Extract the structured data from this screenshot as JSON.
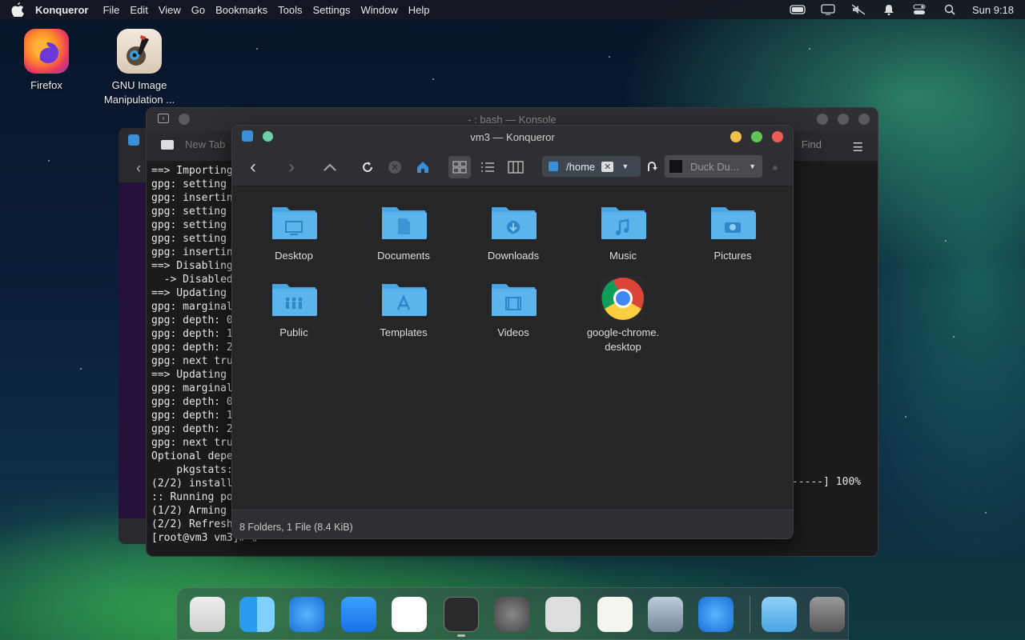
{
  "menubar": {
    "app_name": "Konqueror",
    "menus": [
      "File",
      "Edit",
      "View",
      "Go",
      "Bookmarks",
      "Tools",
      "Settings",
      "Window",
      "Help"
    ],
    "clock": "Sun 9:18"
  },
  "desktop": {
    "icons": [
      {
        "label": "Firefox",
        "icon": "firefox-icon"
      },
      {
        "label": "GNU Image Manipulation ...",
        "icon": "gimp-icon"
      }
    ]
  },
  "konsole": {
    "title": "- : bash — Konsole",
    "new_tab": "New Tab",
    "find": "Find",
    "terminal_lines": [
      "==> Importing",
      "gpg: setting",
      "gpg: insertin",
      "gpg: setting",
      "gpg: setting",
      "gpg: setting",
      "gpg: insertin",
      "==> Disabling",
      "  -> Disabled",
      "==> Updating",
      "gpg: marginal",
      "gpg: depth: 0",
      "gpg: depth: 1",
      "gpg: depth: 2",
      "gpg: next tru",
      "==> Updating",
      "gpg: marginal",
      "gpg: depth: 0",
      "gpg: depth: 1",
      "gpg: depth: 2",
      "gpg: next tru",
      "Optional depe",
      "    pkgstats:",
      "(2/2) install",
      ":: Running po",
      "(1/2) Arming",
      "(2/2) Refresh",
      "[root@vm3 vm3]# ▯"
    ],
    "progress_tail": "-----] 100%"
  },
  "konqueror": {
    "title": "vm3 — Konqueror",
    "address": "/home",
    "search_engine": "Duck Du...",
    "status": "8 Folders, 1 File (8.4 KiB)",
    "items": [
      {
        "label": "Desktop",
        "type": "folder",
        "glyph": "desktop-icon"
      },
      {
        "label": "Documents",
        "type": "folder",
        "glyph": "document-icon"
      },
      {
        "label": "Downloads",
        "type": "folder",
        "glyph": "download-icon"
      },
      {
        "label": "Music",
        "type": "folder",
        "glyph": "music-icon"
      },
      {
        "label": "Pictures",
        "type": "folder",
        "glyph": "camera-icon"
      },
      {
        "label": "Public",
        "type": "folder",
        "glyph": "people-icon"
      },
      {
        "label": "Templates",
        "type": "folder",
        "glyph": "template-icon"
      },
      {
        "label": "Videos",
        "type": "folder",
        "glyph": "film-icon"
      },
      {
        "label": "google-chrome.desktop",
        "line1": "google-chrome.",
        "line2": "desktop",
        "type": "file",
        "glyph": "chrome-icon"
      }
    ]
  },
  "dock": {
    "apps": [
      "launchpad-icon",
      "finder-icon",
      "safari-icon",
      "app-store-icon",
      "photos-icon",
      "terminal-icon",
      "settings-icon",
      "cassette-icon",
      "textedit-icon",
      "preview-icon",
      "safari-icon",
      "downloads-folder-icon",
      "trash-icon"
    ]
  },
  "colors": {
    "folder_blue": "#5bb4ec",
    "traffic_yellow": "#f4bf4f",
    "traffic_green": "#61c554",
    "traffic_red": "#ee5d55"
  }
}
